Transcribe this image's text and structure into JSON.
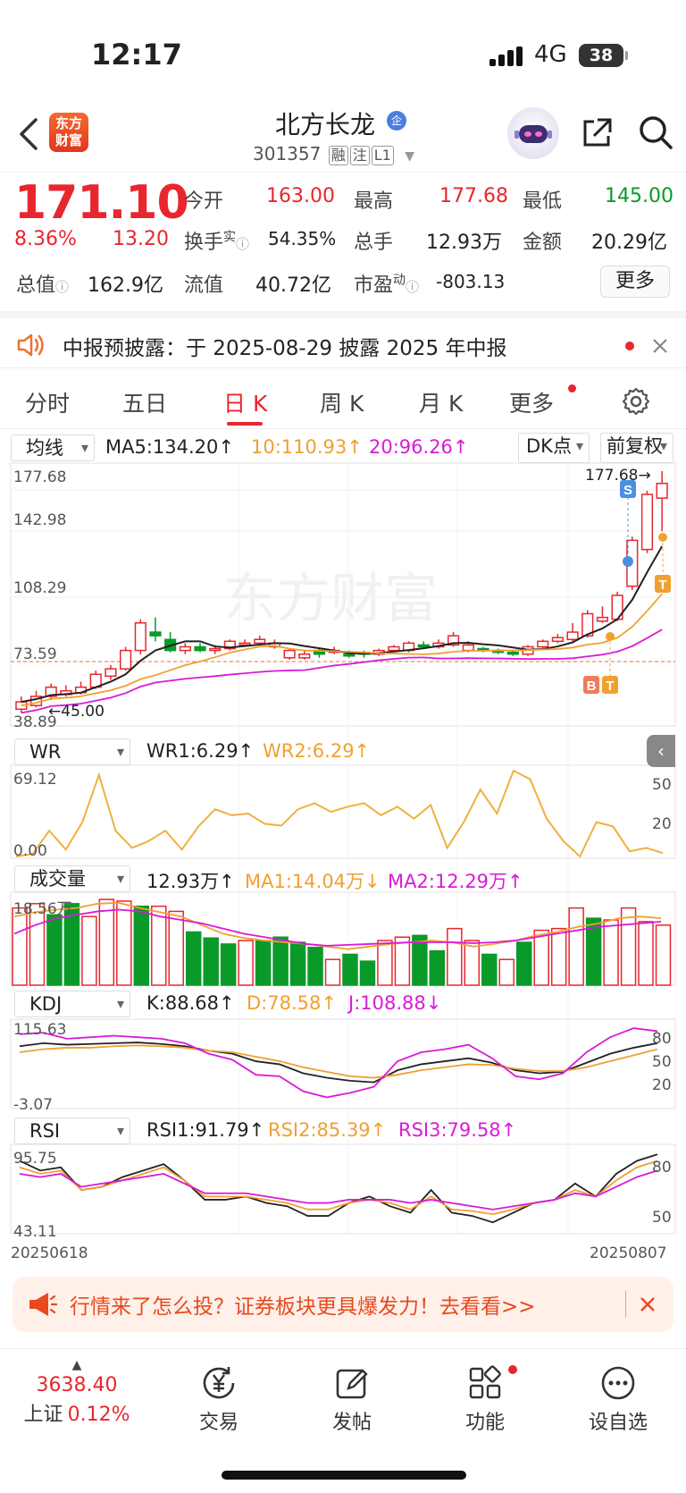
{
  "status": {
    "time": "12:17",
    "network": "4G",
    "battery": "38"
  },
  "header": {
    "logo_line1": "东方",
    "logo_line2": "财富",
    "name": "北方长龙",
    "name_badge": "企",
    "code": "301357",
    "tags": [
      "融",
      "注",
      "L1"
    ]
  },
  "quote": {
    "price": "171.10",
    "change_pct": "8.36%",
    "change": "13.20",
    "open_label": "今开",
    "open": "163.00",
    "high_label": "最高",
    "high": "177.68",
    "low_label": "最低",
    "low": "145.00",
    "turnover_label": "换手",
    "turnover_sup": "实",
    "turnover": "54.35%",
    "volume_label": "总手",
    "volume": "12.93万",
    "amount_label": "金额",
    "amount": "20.29亿",
    "mktcap_label": "总值",
    "mktcap": "162.9亿",
    "float_label": "流值",
    "float": "40.72亿",
    "pe_label": "市盈",
    "pe_sup": "动",
    "pe": "-803.13",
    "more": "更多"
  },
  "notice": {
    "text": "中报预披露：于 2025-08-29 披露 2025 年中报"
  },
  "tabs": [
    "分时",
    "五日",
    "日 K",
    "周 K",
    "月 K",
    "更多"
  ],
  "kline": {
    "selector": "均线",
    "ma5": "MA5:134.20↑",
    "ma10": "10:110.93↑",
    "ma20": "20:96.26↑",
    "dk": "DK点",
    "adjust": "前复权",
    "y_labels": [
      "177.68",
      "142.98",
      "108.29",
      "73.59",
      "38.89"
    ],
    "low_mark": "45.00",
    "high_mark": "177.68→",
    "watermark": "东方财富",
    "sig_s": "S",
    "sig_t": "T",
    "sig_b": "B"
  },
  "wr": {
    "selector": "WR",
    "wr1": "WR1:6.29↑",
    "wr2": "WR2:6.29↑",
    "y_top": "69.12",
    "y_bot": "0.00",
    "r1": "50",
    "r2": "20"
  },
  "vol": {
    "selector": "成交量",
    "v": "12.93万↑",
    "ma1": "MA1:14.04万↓",
    "ma2": "MA2:12.29万↑",
    "y_top": "18.56万"
  },
  "kdj": {
    "selector": "KDJ",
    "k": "K:88.68↑",
    "d": "D:78.58↑",
    "j": "J:108.88↓",
    "y_top": "115.63",
    "y_bot": "-3.07",
    "r1": "80",
    "r2": "50",
    "r3": "20"
  },
  "rsi": {
    "selector": "RSI",
    "rsi1": "RSI1:91.79↑",
    "rsi2": "RSI2:85.39↑",
    "rsi3": "RSI3:79.58↑",
    "y_top": "95.75",
    "y_bot": "43.11",
    "r1": "80",
    "r2": "50"
  },
  "dates": {
    "start": "20250618",
    "end": "20250807"
  },
  "promo": {
    "text": "行情来了怎么投？证券板块更具爆发力！去看看>>"
  },
  "nav": {
    "index_value": "3638.40",
    "index_name": "上证",
    "index_change": "0.12%",
    "trade": "交易",
    "post": "发帖",
    "func": "功能",
    "watch": "设自选"
  },
  "colors": {
    "up": "#e8262e",
    "down": "#0a9a2a",
    "ma5": "#222222",
    "ma10": "#f0a030",
    "ma20": "#d91ad9"
  }
}
